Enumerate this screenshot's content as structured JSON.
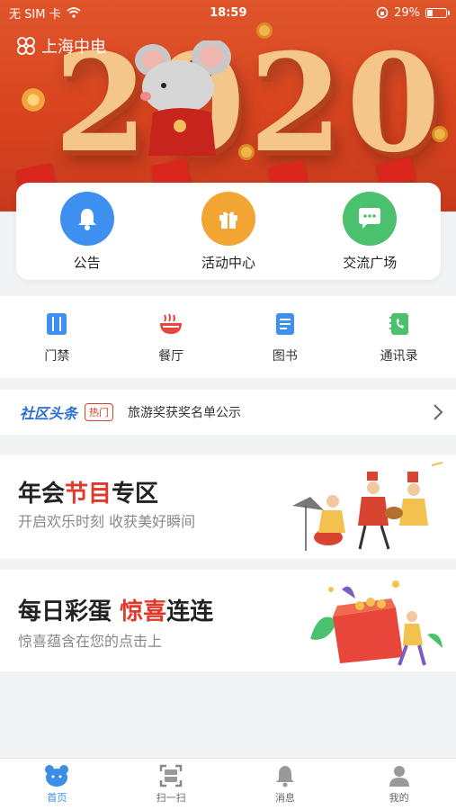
{
  "status_bar": {
    "carrier": "无 SIM 卡",
    "time": "18:59",
    "battery": "29%"
  },
  "banner": {
    "logo_text": "上海中电",
    "year": "2020"
  },
  "quick_actions": [
    {
      "label": "公告",
      "icon": "bell-icon",
      "color": "#3d8ff0"
    },
    {
      "label": "活动中心",
      "icon": "gift-icon",
      "color": "#f2a533"
    },
    {
      "label": "交流广场",
      "icon": "chat-icon",
      "color": "#4bc16d"
    }
  ],
  "services": [
    {
      "label": "门禁",
      "icon": "door-access-icon",
      "color": "#3d8ff0"
    },
    {
      "label": "餐厅",
      "icon": "restaurant-icon",
      "color": "#e8463a"
    },
    {
      "label": "图书",
      "icon": "book-icon",
      "color": "#3d8ff0"
    },
    {
      "label": "通讯录",
      "icon": "contacts-icon",
      "color": "#4bc16d"
    }
  ],
  "news": {
    "brand": "社区头条",
    "hot_badge": "热门",
    "headline": "旅游奖获奖名单公示"
  },
  "promo1": {
    "title_a": "年会",
    "title_b": "节目",
    "title_c": "专区",
    "subtitle": "开启欢乐时刻  收获美好瞬间"
  },
  "promo2": {
    "title_a": "每日彩蛋  ",
    "title_b": "惊喜",
    "title_c": "连连",
    "subtitle": "惊喜蕴含在您的点击上"
  },
  "tabs": [
    {
      "label": "首页",
      "icon": "home-bear-icon",
      "active": true
    },
    {
      "label": "扫一扫",
      "icon": "scan-icon",
      "active": false
    },
    {
      "label": "消息",
      "icon": "message-bell-icon",
      "active": false
    },
    {
      "label": "我的",
      "icon": "profile-icon",
      "active": false
    }
  ],
  "colors": {
    "accent": "#3a8ee6",
    "banner_red": "#d8441f",
    "highlight_red": "#e0392b"
  }
}
